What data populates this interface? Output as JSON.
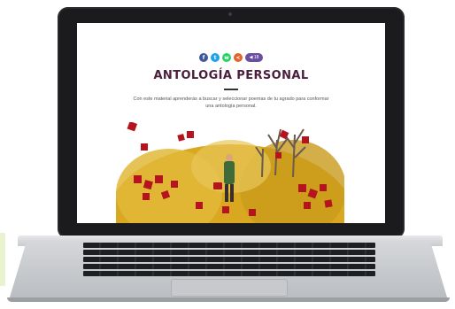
{
  "page": {
    "title": "ANTOLOGÍA PERSONAL",
    "description": "Con este material aprenderás a buscar y seleccionar poemas de tu agrado para conformar una antología personal."
  },
  "share": {
    "buttons": [
      {
        "name": "facebook-icon",
        "glyph": "f",
        "color": "#3b5998"
      },
      {
        "name": "twitter-icon",
        "glyph": "t",
        "color": "#1da1f2"
      },
      {
        "name": "whatsapp-icon",
        "glyph": "w",
        "color": "#25d366"
      },
      {
        "name": "share-icon",
        "glyph": "<",
        "color": "#e2632e"
      }
    ],
    "pill_label": "◀ 18"
  },
  "colors": {
    "title": "#4a1e3c",
    "puzzle_red": "#b5131e",
    "leaves": "#d9a820"
  }
}
